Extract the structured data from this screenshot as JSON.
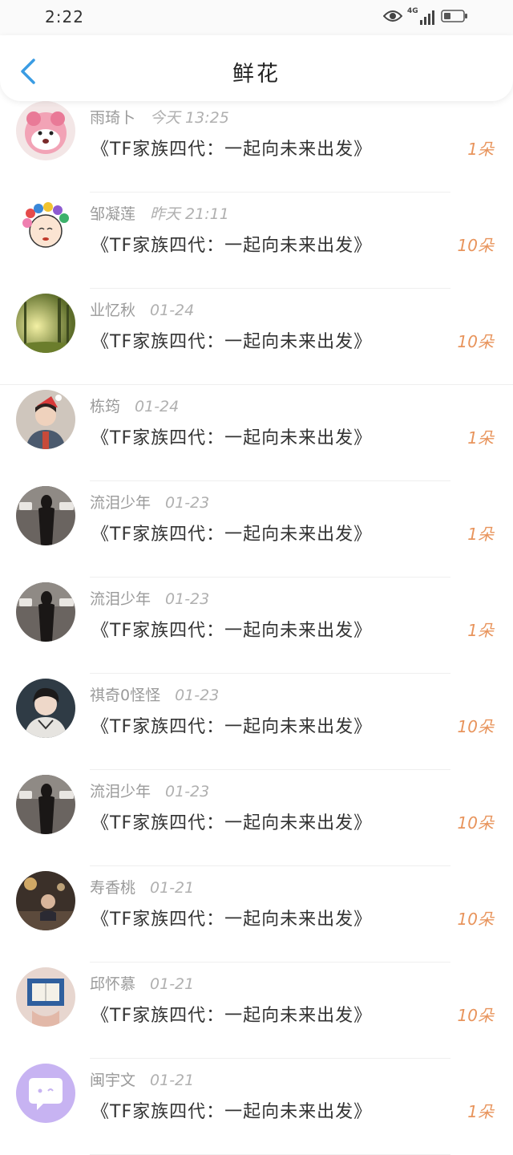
{
  "status_bar": {
    "time": "2:22",
    "network": "4G"
  },
  "header": {
    "title": "鲜花"
  },
  "colors": {
    "accent": "#3a9ce3",
    "count": "#e8945c"
  },
  "list": [
    {
      "name": "雨琦卜",
      "time": "今天 13:25",
      "title": "《TF家族四代：一起向未来出发》",
      "count": "1朵",
      "avatar": "strawberry-bear"
    },
    {
      "name": "邹凝莲",
      "time": "昨天 21:11",
      "title": "《TF家族四代：一起向未来出发》",
      "count": "10朵",
      "avatar": "cartoon-girl"
    },
    {
      "name": "业忆秋",
      "time": "01-24",
      "title": "《TF家族四代：一起向未来出发》",
      "count": "10朵",
      "avatar": "forest"
    },
    {
      "name": "栋筠",
      "time": "01-24",
      "title": "《TF家族四代：一起向未来出发》",
      "count": "1朵",
      "avatar": "boy-santa-hat"
    },
    {
      "name": "流泪少年",
      "time": "01-23",
      "title": "《TF家族四代：一起向未来出发》",
      "count": "1朵",
      "avatar": "silhouette-street"
    },
    {
      "name": "流泪少年",
      "time": "01-23",
      "title": "《TF家族四代：一起向未来出发》",
      "count": "1朵",
      "avatar": "silhouette-street"
    },
    {
      "name": "祺奇0怪怪",
      "time": "01-23",
      "title": "《TF家族四代：一起向未来出发》",
      "count": "10朵",
      "avatar": "boy-portrait"
    },
    {
      "name": "流泪少年",
      "time": "01-23",
      "title": "《TF家族四代：一起向未来出发》",
      "count": "10朵",
      "avatar": "silhouette-street"
    },
    {
      "name": "寿香桃",
      "time": "01-21",
      "title": "《TF家族四代：一起向未来出发》",
      "count": "10朵",
      "avatar": "night-room"
    },
    {
      "name": "邱怀慕",
      "time": "01-21",
      "title": "《TF家族四代：一起向未来出发》",
      "count": "10朵",
      "avatar": "book-photo"
    },
    {
      "name": "闽宇文",
      "time": "01-21",
      "title": "《TF家族四代：一起向未来出发》",
      "count": "1朵",
      "avatar": "default-chat"
    }
  ]
}
